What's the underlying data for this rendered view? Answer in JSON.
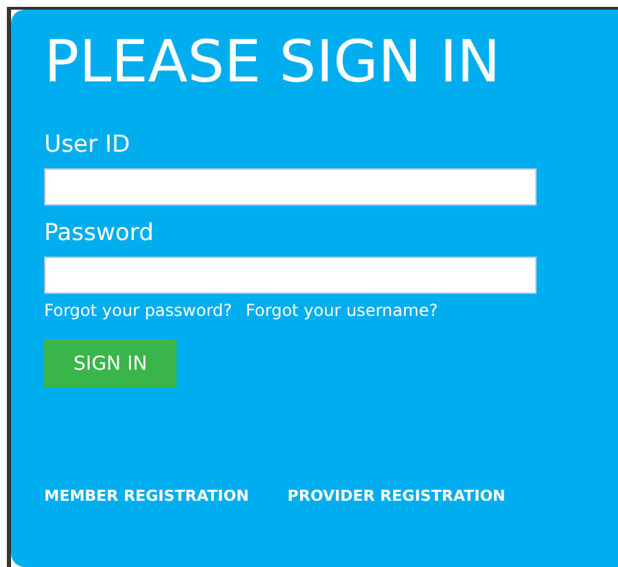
{
  "title": "PLEASE SIGN IN",
  "fields": [
    {
      "label": "User ID"
    },
    {
      "label": "Password"
    }
  ],
  "help_links": [
    "Forgot your password?",
    "Forgot your username?"
  ],
  "sign_in_button": "SIGN IN",
  "registration_links": [
    "MEMBER REGISTRATION",
    "PROVIDER REGISTRATION"
  ]
}
